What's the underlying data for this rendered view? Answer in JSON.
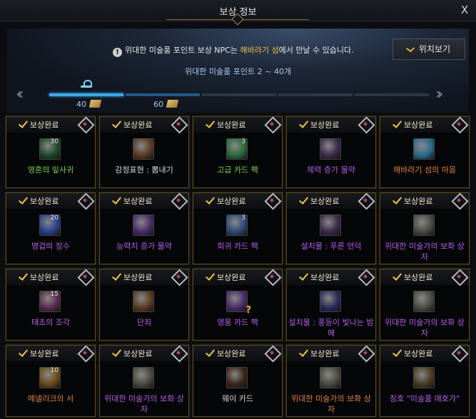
{
  "window": {
    "title": "보상 정보",
    "close_label": "X"
  },
  "banner": {
    "notice_icon": "!",
    "notice_prefix": "위대한 미술품 포인트 보상 NPC는 ",
    "notice_highlight": "해바라기 섬",
    "notice_suffix": "에서 만날 수 있습니다.",
    "location_button": "위치보기",
    "range_label": "위대한 미술품 포인트 2 ~ 40개",
    "stops": [
      {
        "value": "40"
      },
      {
        "value": "60"
      }
    ]
  },
  "rewards": {
    "status_label": "보상완료",
    "items": [
      {
        "name": "영혼의 잎사귀",
        "qty": "30",
        "color": "c-green",
        "bg": "#1d4a2a",
        "q": ""
      },
      {
        "name": "감정표현 : 뽐내기",
        "qty": "",
        "color": "c-white",
        "bg": "#5a3a22",
        "q": ""
      },
      {
        "name": "고급 카드 팩",
        "qty": "3",
        "color": "c-green",
        "bg": "#2a6a3a",
        "q": ""
      },
      {
        "name": "체력 증가 물약",
        "qty": "",
        "color": "c-purple",
        "bg": "#3a2a4a",
        "q": ""
      },
      {
        "name": "해바라기 섬의 마음",
        "qty": "",
        "color": "c-orange",
        "bg": "#2a6a8a",
        "q": ""
      },
      {
        "name": "명겁의 정수",
        "qty": "20",
        "color": "c-purple",
        "bg": "#2a3f8a",
        "q": ""
      },
      {
        "name": "능력치 증가 물약",
        "qty": "",
        "color": "c-purple",
        "bg": "#4a2a6a",
        "q": ""
      },
      {
        "name": "희귀 카드 팩",
        "qty": "3",
        "color": "c-purple",
        "bg": "#2a4a7a",
        "q": ""
      },
      {
        "name": "설치물 : 푸른 언덕",
        "qty": "",
        "color": "c-purple",
        "bg": "#3a2a4a",
        "q": ""
      },
      {
        "name": "위대한 미술가의 보화 상자",
        "qty": "",
        "color": "c-purple",
        "bg": "#4a4a40",
        "q": ""
      },
      {
        "name": "태초의 조각",
        "qty": "15",
        "color": "c-purple",
        "bg": "#5a2a4a",
        "q": ""
      },
      {
        "name": "단죄",
        "qty": "",
        "color": "c-purple",
        "bg": "#5a3a20",
        "q": ""
      },
      {
        "name": "영웅 카드 팩",
        "qty": "",
        "color": "c-purple",
        "bg": "#4a2a6a",
        "q": "?"
      },
      {
        "name": "설치물 : 풍등이 빛나는 밤에",
        "qty": "",
        "color": "c-purple",
        "bg": "#2a2a5a",
        "q": ""
      },
      {
        "name": "위대한 미술가의 보화 상자",
        "qty": "",
        "color": "c-purple",
        "bg": "#4a4a40",
        "q": ""
      },
      {
        "name": "메넬리크의 서",
        "qty": "10",
        "color": "c-orange",
        "bg": "#6a4a1a",
        "q": ""
      },
      {
        "name": "위대한 미술가의 보화 상자",
        "qty": "",
        "color": "c-purple",
        "bg": "#4a4a40",
        "q": ""
      },
      {
        "name": "웨이 카드",
        "qty": "",
        "color": "c-white",
        "bg": "#3a2418",
        "q": ""
      },
      {
        "name": "위대한 미술가의 보화 상자",
        "qty": "",
        "color": "c-orange",
        "bg": "#4a4a40",
        "q": ""
      },
      {
        "name": "칭호 \"미술품 애호가\"",
        "qty": "",
        "color": "c-purple",
        "bg": "#4a3a20",
        "q": ""
      }
    ]
  }
}
